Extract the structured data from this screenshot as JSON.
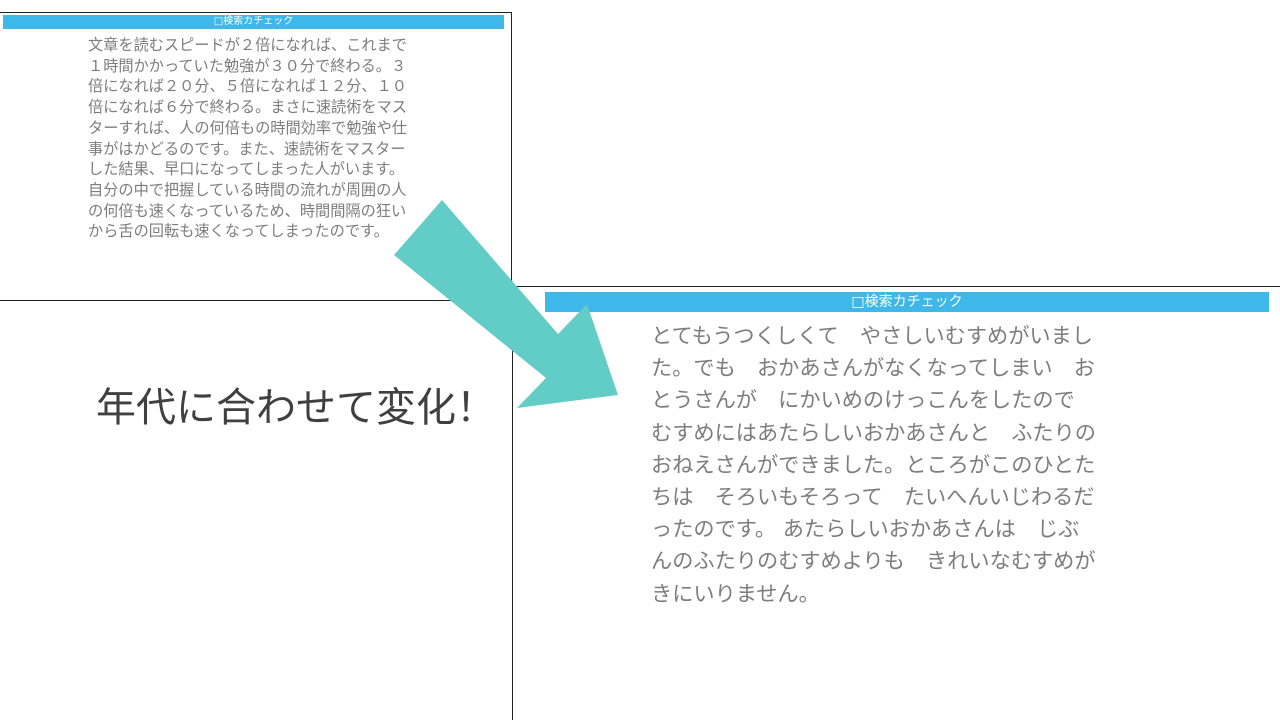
{
  "top_panel": {
    "header": "□検索カチェック",
    "body": "文章を読むスピードが２倍になれば、これまで\n１時間かかっていた勉強が３０分で終わる。３\n倍になれば２０分、５倍になれば１２分、１０\n倍になれば６分で終わる。まさに速読術をマス\nターすれば、人の何倍もの時間効率で勉強や仕\n事がはかどるのです。また、速読術をマスター\nした結果、早口になってしまった人がいます。\n自分の中で把握している時間の流れが周囲の人\nの何倍も速くなっているため、時間間隔の狂い\nから舌の回転も速くなってしまったのです。"
  },
  "bottom_panel": {
    "header": "□検索カチェック",
    "body": "とてもうつくしくて　やさしいむすめがいまし\nた。でも　おかあさんがなくなってしまい　お\nとうさんが　にかいめのけっこんをしたので\nむすめにはあたらしいおかあさんと　ふたりの\nおねえさんができました。ところがこのひとた\nちは　そろいもそろって　たいへんいじわるだ\nったのです。 あたらしいおかあさんは　じぶ\nんのふたりのむすめよりも　きれいなむすめが\nきにいりません。"
  },
  "caption": "年代に合わせて変化！",
  "colors": {
    "header_bg": "#3db8e8",
    "arrow": "#62ccc6",
    "body_text": "#7d7d7d",
    "caption_text": "#404040"
  }
}
